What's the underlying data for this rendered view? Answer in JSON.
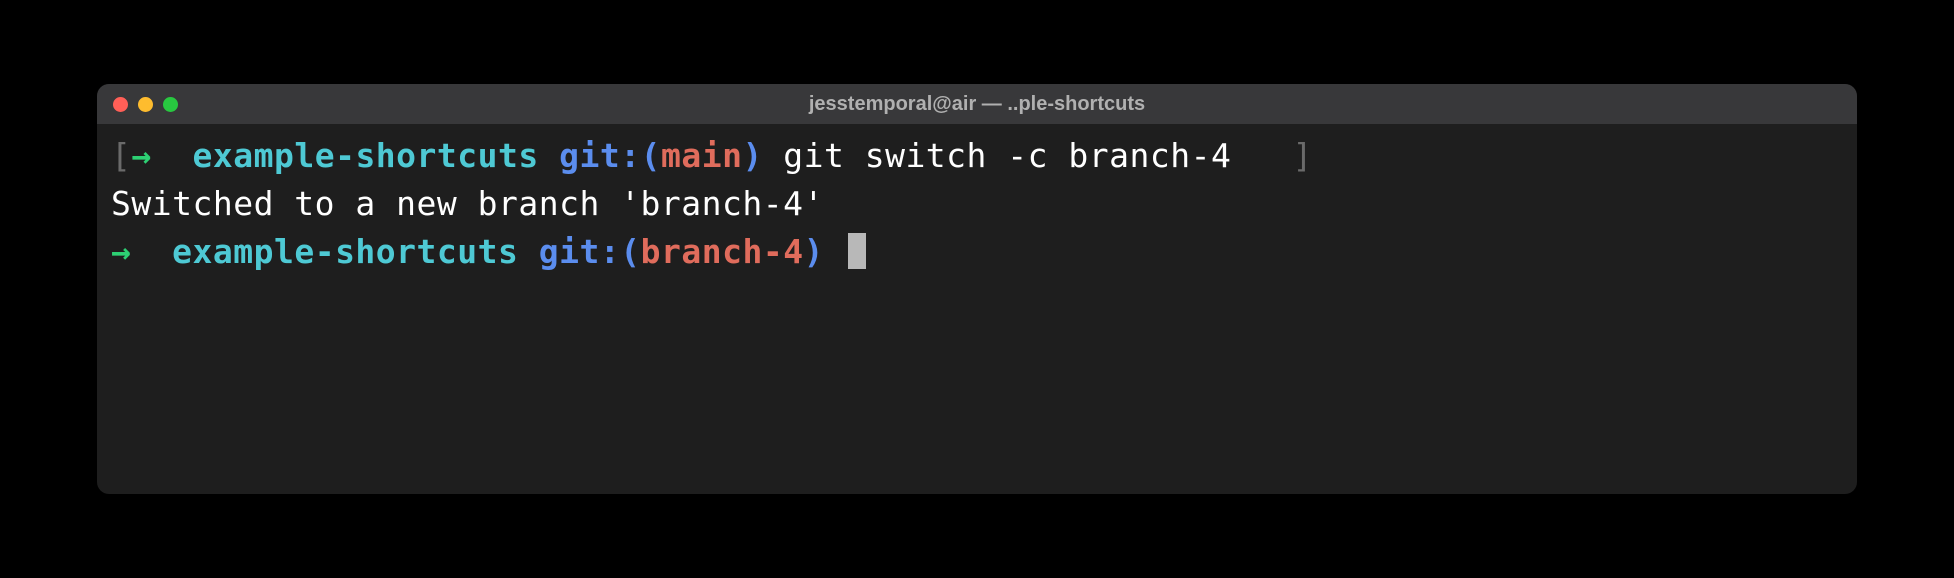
{
  "window": {
    "title": "jesstemporal@air — ..ple-shortcuts"
  },
  "line1": {
    "bracket_open": "[",
    "arrow": "→",
    "dir": "example-shortcuts",
    "git_label": "git:",
    "paren_open": "(",
    "branch": "main",
    "paren_close": ")",
    "command": "git switch -c branch-4",
    "bracket_close": "]"
  },
  "line2": {
    "output": "Switched to a new branch 'branch-4'"
  },
  "line3": {
    "arrow": "→",
    "dir": "example-shortcuts",
    "git_label": "git:",
    "paren_open": "(",
    "branch": "branch-4",
    "paren_close": ")"
  }
}
